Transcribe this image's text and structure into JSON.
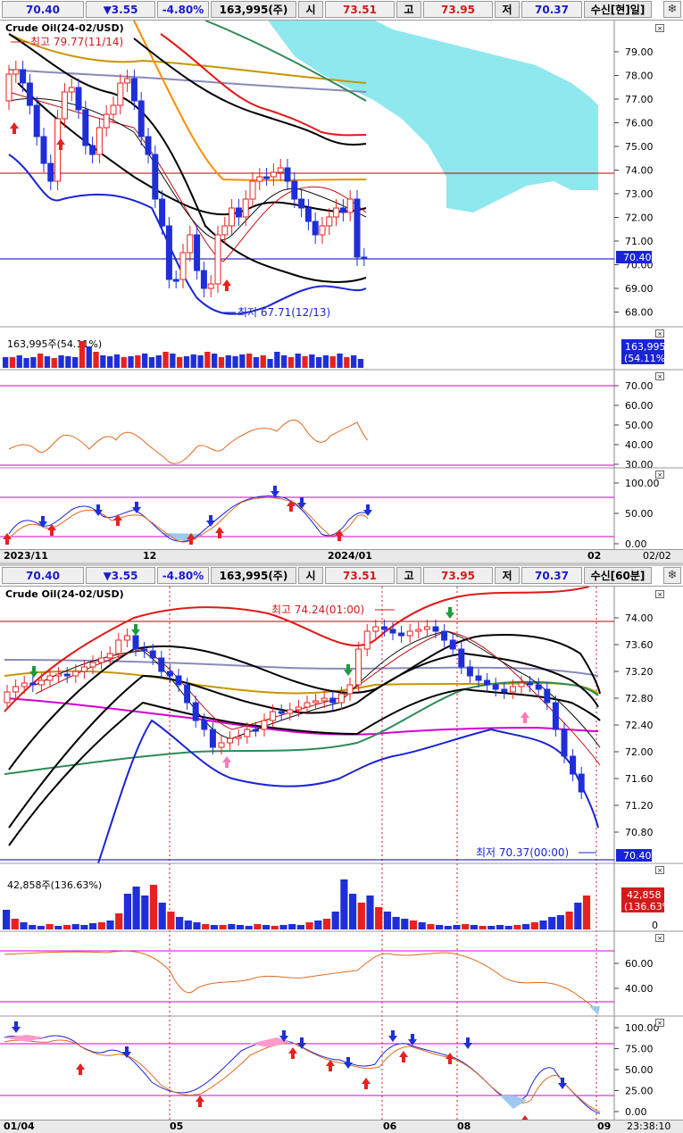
{
  "top": {
    "header": {
      "last": "70.40",
      "change": "▼3.55",
      "pct": "-4.80%",
      "volume": "163,995(주)",
      "open_label": "시",
      "open": "73.51",
      "high_label": "고",
      "high": "73.95",
      "low_label": "저",
      "low": "70.37",
      "mode": "수신[현]일]"
    },
    "title": "Crude Oil(24-02/USD)",
    "high_annotation": "최고 79.77(11/14)",
    "low_annotation": "최저 67.71(12/13)",
    "price_ticks": [
      "79.00",
      "78.00",
      "77.00",
      "76.00",
      "75.00",
      "74.00",
      "73.00",
      "72.00",
      "71.00",
      "70.00",
      "69.00",
      "68.00"
    ],
    "current_price_tag": "70.40",
    "volume_label": "163,995주(54.11%)",
    "volume_tag_value": "163,995",
    "volume_tag_pct": "(54.11%)",
    "rsi_ticks": [
      "70.00",
      "60.00",
      "50.00",
      "40.00",
      "30.00"
    ],
    "stoch_ticks": [
      "100.00",
      "50.00",
      "0.00"
    ],
    "dates": [
      "2023/11",
      "12",
      "2024/01",
      "02"
    ],
    "date_right": "02/02"
  },
  "bottom": {
    "header": {
      "last": "70.40",
      "change": "▼3.55",
      "pct": "-4.80%",
      "volume": "163,995(주)",
      "open_label": "시",
      "open": "73.51",
      "high_label": "고",
      "high": "73.95",
      "low_label": "저",
      "low": "70.37",
      "mode": "수신[60분]"
    },
    "title": "Crude Oil(24-02/USD)",
    "high_annotation": "최고 74.24(01:00)",
    "low_annotation": "최저 70.37(00:00)",
    "price_ticks": [
      "74.00",
      "73.60",
      "73.20",
      "72.80",
      "72.40",
      "72.00",
      "71.60",
      "71.20",
      "70.80"
    ],
    "current_price_tag": "70.40",
    "volume_label": "42,858주(136.63%)",
    "volume_tag_value": "42,858",
    "volume_tag_pct": "(136.63%)",
    "volume_zero": "0",
    "rsi_ticks": [
      "60.00",
      "40.00"
    ],
    "stoch_ticks": [
      "100.00",
      "75.00",
      "50.00",
      "25.00",
      "0.00"
    ],
    "dates": [
      "01/04",
      "05",
      "06",
      "08",
      "09"
    ],
    "date_right": "23:38:10"
  },
  "colors": {
    "up": "#e8211f",
    "down": "#1f2fd8",
    "ichimoku_cloud": "#8ee8ee",
    "magenta": "#d400d4"
  }
}
